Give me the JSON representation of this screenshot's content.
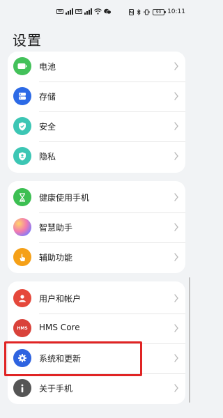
{
  "status": {
    "sim1": "HD",
    "sim2": "HD",
    "battery": "90",
    "time": "10:11"
  },
  "page_title": "设置",
  "groups": [
    {
      "items": [
        {
          "label": "电池",
          "icon": "battery-icon",
          "color": "#43c15a"
        },
        {
          "label": "存储",
          "icon": "storage-icon",
          "color": "#2c6ae6"
        },
        {
          "label": "安全",
          "icon": "shield-check-icon",
          "color": "#3cc6b4"
        },
        {
          "label": "隐私",
          "icon": "privacy-shield-icon",
          "color": "#3cc6b4"
        }
      ]
    },
    {
      "items": [
        {
          "label": "健康使用手机",
          "icon": "hourglass-icon",
          "color": "#3cbf52"
        },
        {
          "label": "智慧助手",
          "icon": "smart-assistant-icon",
          "color": "#c57ee0"
        },
        {
          "label": "辅助功能",
          "icon": "hand-tap-icon",
          "color": "#f5a017"
        }
      ]
    },
    {
      "items": [
        {
          "label": "用户和帐户",
          "icon": "user-icon",
          "color": "#e5483b"
        },
        {
          "label": "HMS Core",
          "icon": "hms-core-icon",
          "color": "#d9423a",
          "badge": "HMS"
        },
        {
          "label": "系统和更新",
          "icon": "gear-icon",
          "color": "#2e63e0"
        },
        {
          "label": "关于手机",
          "icon": "info-icon",
          "color": "#555555"
        }
      ]
    }
  ],
  "colors": {
    "background": "#f1f3f5",
    "card": "#ffffff",
    "highlight": "#e02424"
  }
}
